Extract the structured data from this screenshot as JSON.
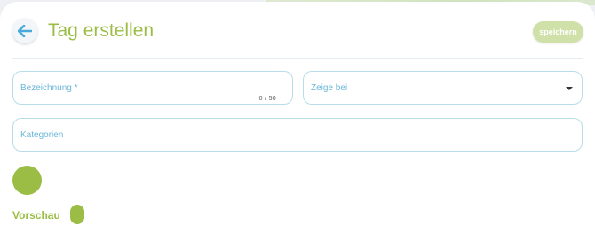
{
  "header": {
    "title": "Tag erstellen",
    "back_icon": "arrow-left-icon",
    "save_label": "speichern"
  },
  "form": {
    "name_field": {
      "label": "Bezeichnung *",
      "counter": "0 / 50",
      "value": ""
    },
    "show_at_select": {
      "label": "Zeige bei",
      "selected": "",
      "icon": "caret-down-icon"
    },
    "categories_field": {
      "label": "Kategorien",
      "value": ""
    },
    "color": "#9bbd45"
  },
  "preview": {
    "label": "Vorschau",
    "tag_text": ""
  },
  "colors": {
    "accent": "#9bbd45",
    "save_button": "#cfe0a8",
    "field_border": "#b8dde8",
    "field_label": "#6ab7d8",
    "back_arrow": "#4aa9dc"
  }
}
